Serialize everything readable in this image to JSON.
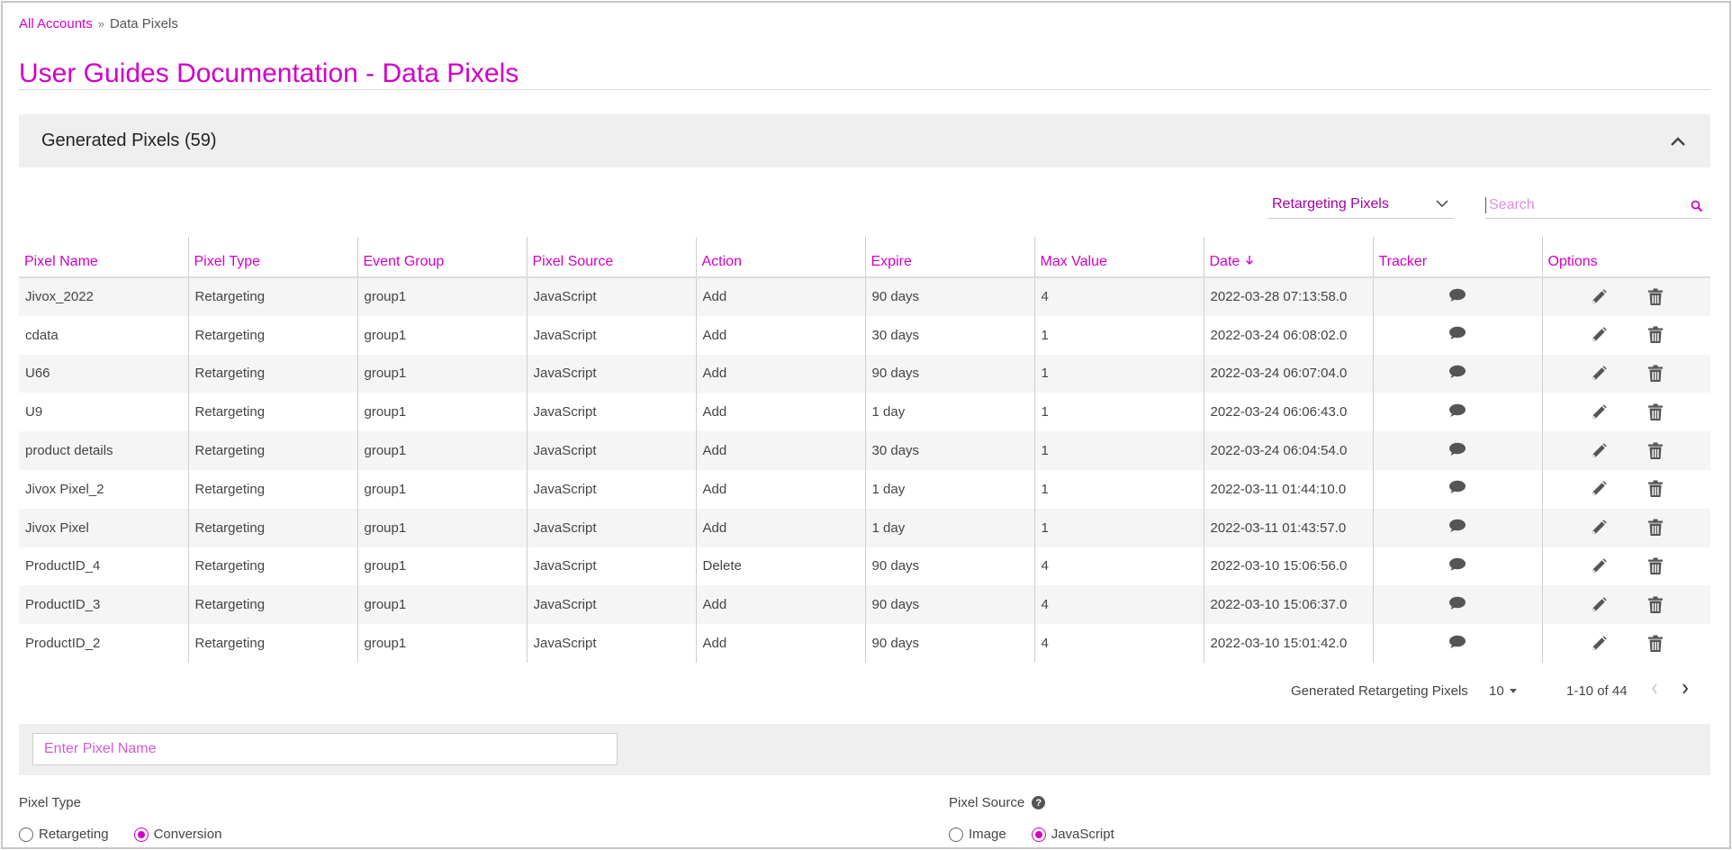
{
  "breadcrumb": {
    "root": "All Accounts",
    "separator": "»",
    "current": "Data Pixels"
  },
  "page_title": "User Guides Documentation - Data Pixels",
  "section": {
    "title": "Generated Pixels (59)"
  },
  "filter": {
    "selected": "Retargeting Pixels"
  },
  "search": {
    "placeholder": "Search"
  },
  "table": {
    "headers": {
      "name": "Pixel Name",
      "type": "Pixel Type",
      "group": "Event Group",
      "source": "Pixel Source",
      "action": "Action",
      "expire": "Expire",
      "max": "Max Value",
      "date": "Date",
      "tracker": "Tracker",
      "options": "Options"
    },
    "rows": [
      {
        "name": "Jivox_2022",
        "type": "Retargeting",
        "group": "group1",
        "source": "JavaScript",
        "action": "Add",
        "expire": "90 days",
        "max": "4",
        "date": "2022-03-28 07:13:58.0"
      },
      {
        "name": "cdata",
        "type": "Retargeting",
        "group": "group1",
        "source": "JavaScript",
        "action": "Add",
        "expire": "30 days",
        "max": "1",
        "date": "2022-03-24 06:08:02.0"
      },
      {
        "name": "U66",
        "type": "Retargeting",
        "group": "group1",
        "source": "JavaScript",
        "action": "Add",
        "expire": "90 days",
        "max": "1",
        "date": "2022-03-24 06:07:04.0"
      },
      {
        "name": "U9",
        "type": "Retargeting",
        "group": "group1",
        "source": "JavaScript",
        "action": "Add",
        "expire": "1 day",
        "max": "1",
        "date": "2022-03-24 06:06:43.0"
      },
      {
        "name": "product details",
        "type": "Retargeting",
        "group": "group1",
        "source": "JavaScript",
        "action": "Add",
        "expire": "30 days",
        "max": "1",
        "date": "2022-03-24 06:04:54.0"
      },
      {
        "name": "Jivox Pixel_2",
        "type": "Retargeting",
        "group": "group1",
        "source": "JavaScript",
        "action": "Add",
        "expire": "1 day",
        "max": "1",
        "date": "2022-03-11 01:44:10.0"
      },
      {
        "name": "Jivox Pixel",
        "type": "Retargeting",
        "group": "group1",
        "source": "JavaScript",
        "action": "Add",
        "expire": "1 day",
        "max": "1",
        "date": "2022-03-11 01:43:57.0"
      },
      {
        "name": "ProductID_4",
        "type": "Retargeting",
        "group": "group1",
        "source": "JavaScript",
        "action": "Delete",
        "expire": "90 days",
        "max": "4",
        "date": "2022-03-10 15:06:56.0"
      },
      {
        "name": "ProductID_3",
        "type": "Retargeting",
        "group": "group1",
        "source": "JavaScript",
        "action": "Add",
        "expire": "90 days",
        "max": "4",
        "date": "2022-03-10 15:06:37.0"
      },
      {
        "name": "ProductID_2",
        "type": "Retargeting",
        "group": "group1",
        "source": "JavaScript",
        "action": "Add",
        "expire": "90 days",
        "max": "4",
        "date": "2022-03-10 15:01:42.0"
      }
    ]
  },
  "pagination": {
    "label": "Generated Retargeting Pixels",
    "page_size": "10",
    "range": "1-10 of 44"
  },
  "form": {
    "name_placeholder": "Enter Pixel Name",
    "pixel_type": {
      "label": "Pixel Type",
      "options": [
        "Retargeting",
        "Conversion"
      ],
      "selected": "Conversion"
    },
    "pixel_source": {
      "label": "Pixel Source",
      "help": "?",
      "options": [
        "Image",
        "JavaScript"
      ],
      "selected": "JavaScript"
    }
  },
  "colors": {
    "accent": "#d100c8",
    "band": "#efefef",
    "stripe": "#f5f5f5",
    "icon": "#555555"
  },
  "icons": {
    "collapse": "chevron-up-icon",
    "filter": "chevron-down-icon",
    "search": "search-icon",
    "tracker": "comment-icon",
    "edit": "pencil-icon",
    "delete": "trash-icon",
    "sort": "arrow-down-icon"
  }
}
